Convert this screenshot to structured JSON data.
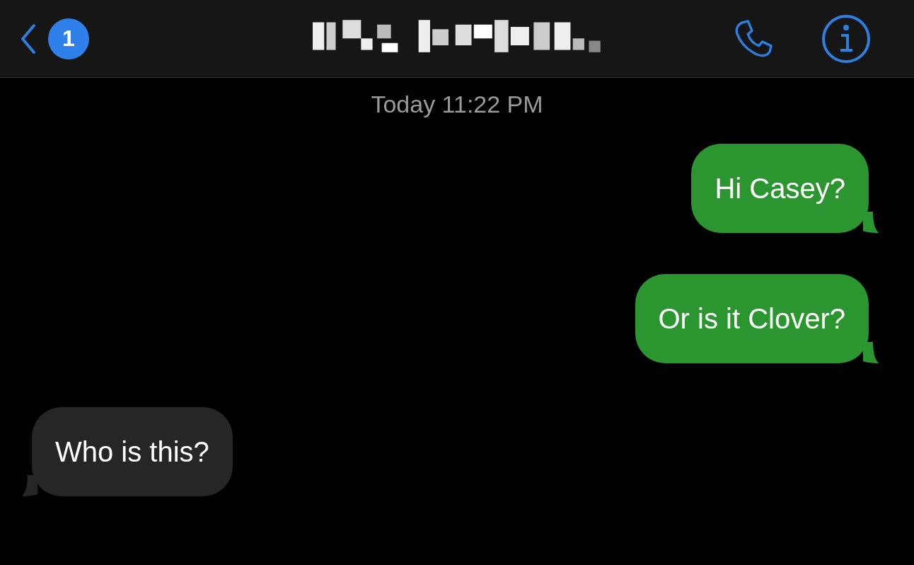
{
  "header": {
    "unread_count": "1"
  },
  "timestamp": "Today 11:22 PM",
  "messages": [
    {
      "kind": "sent",
      "text": "Hi Casey?"
    },
    {
      "kind": "sent",
      "text": "Or is it Clover?"
    },
    {
      "kind": "received",
      "text": "Who is this?"
    }
  ]
}
